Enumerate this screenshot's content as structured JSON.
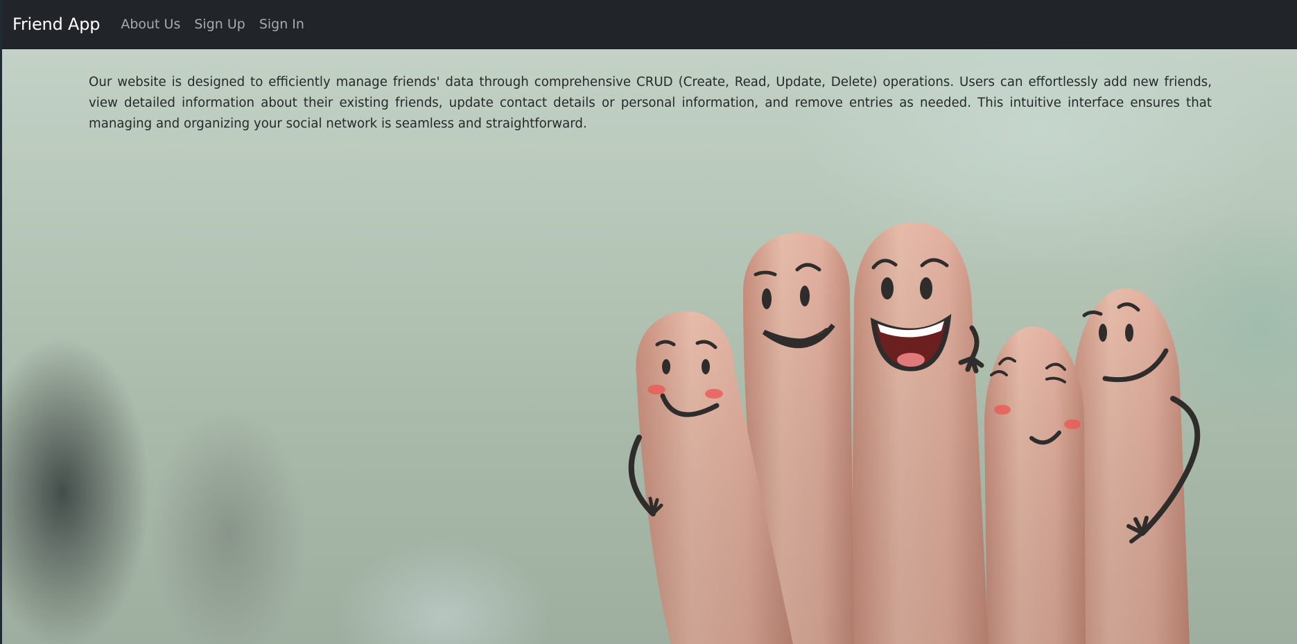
{
  "navbar": {
    "brand": "Friend App",
    "links": [
      "About Us",
      "Sign Up",
      "Sign In"
    ]
  },
  "hero": {
    "intro_text": "Our website is designed to efficiently manage friends' data through comprehensive CRUD (Create, Read, Update, Delete) operations. Users can effortlessly add new friends, view detailed information about their existing friends, update contact details or personal information, and remove entries as needed. This intuitive interface ensures that managing and organizing your social network is seamless and straightforward.",
    "image_subject": "smiling-fingers-illustration"
  },
  "colors": {
    "navbar_bg": "#212529",
    "brand_text": "#ffffff",
    "nav_link_text": "#a7abaf",
    "body_text": "#26292b",
    "finger_skin": "#e2b3a3",
    "face_ink": "#2f2c2c",
    "cheek": "#ea5a55"
  }
}
